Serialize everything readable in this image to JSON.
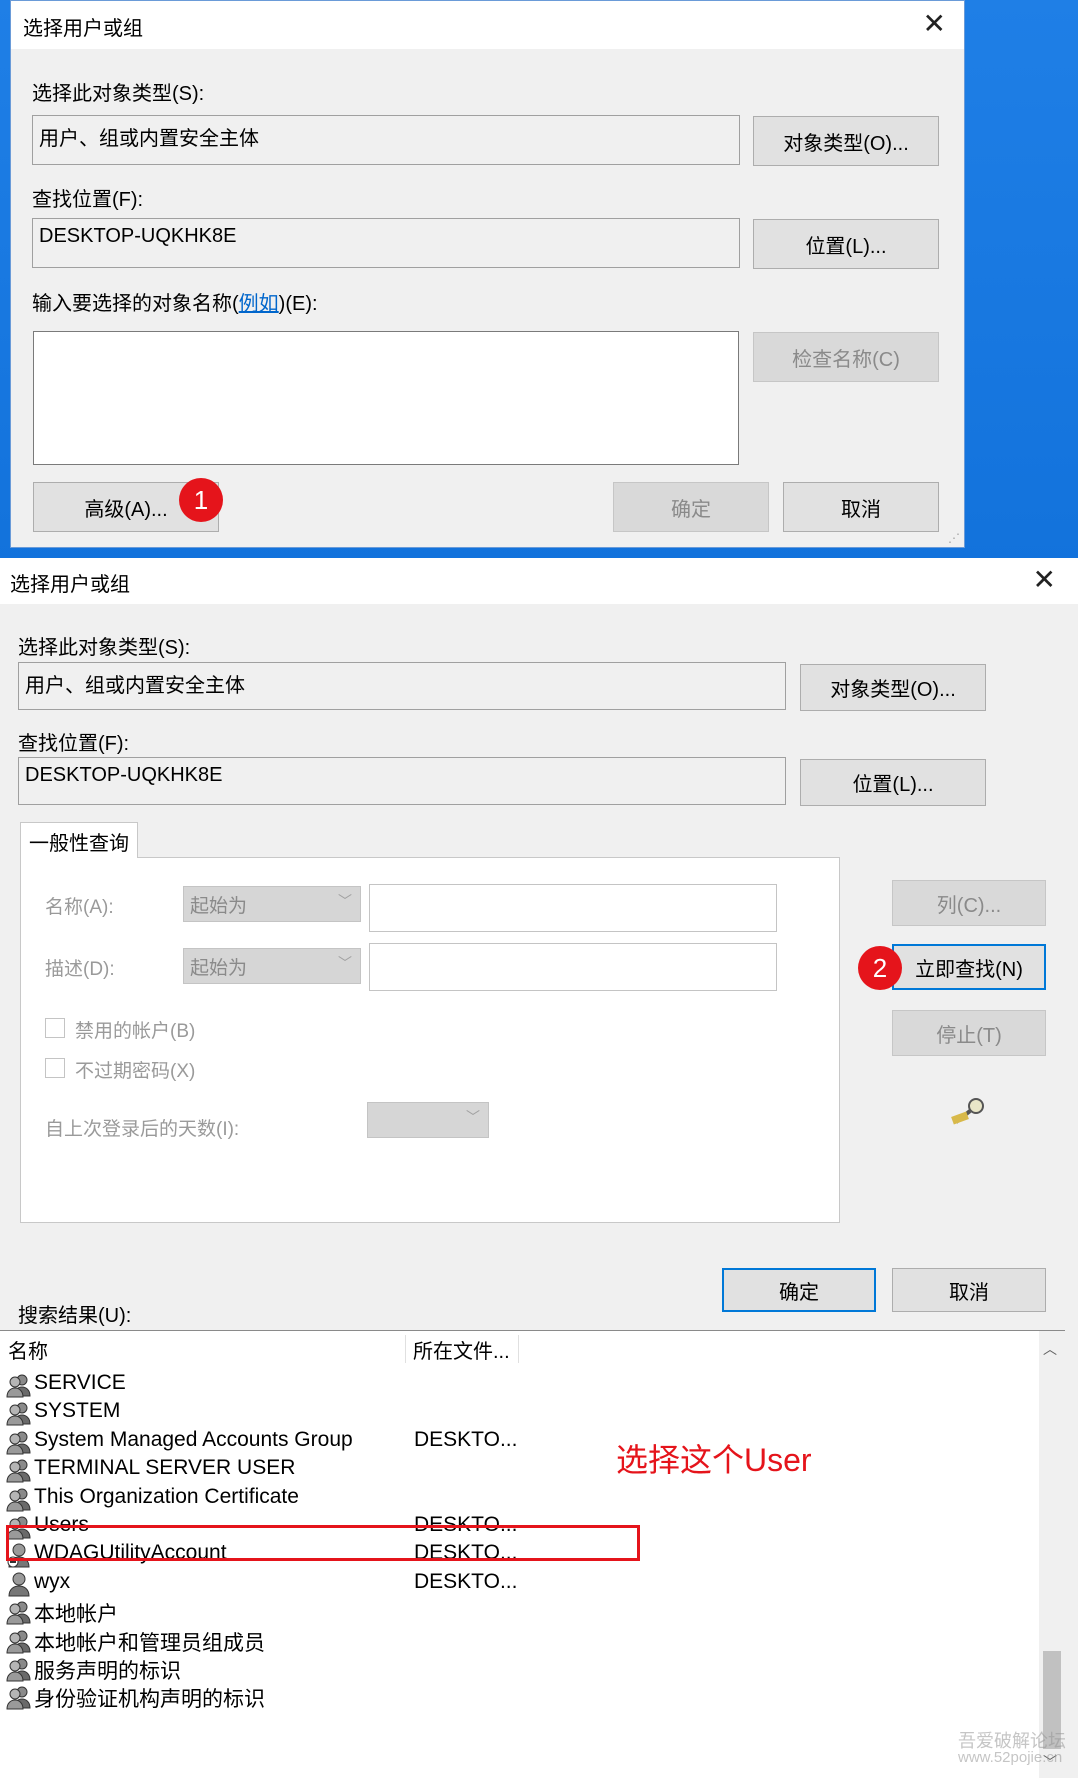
{
  "dialog1": {
    "title": "选择用户或组",
    "object_types_label": "选择此对象类型(S):",
    "object_types_value": "用户、组或内置安全主体",
    "object_types_button": "对象类型(O)...",
    "location_label": "查找位置(F):",
    "location_value": "DESKTOP-UQKHK8E",
    "location_button": "位置(L)...",
    "enter_names_prefix": "输入要选择的对象名称(",
    "enter_names_link": "例如",
    "enter_names_suffix": ")(E):",
    "check_names_button": "检查名称(C)",
    "advanced_button": "高级(A)...",
    "ok_button": "确定",
    "cancel_button": "取消",
    "badge": "1"
  },
  "dialog2": {
    "title": "选择用户或组",
    "object_types_label": "选择此对象类型(S):",
    "object_types_value": "用户、组或内置安全主体",
    "object_types_button": "对象类型(O)...",
    "location_label": "查找位置(F):",
    "location_value": "DESKTOP-UQKHK8E",
    "location_button": "位置(L)...",
    "tab_label": "一般性查询",
    "name_label": "名称(A):",
    "name_combo": "起始为",
    "desc_label": "描述(D):",
    "desc_combo": "起始为",
    "disabled_accounts": "禁用的帐户(B)",
    "non_expiring": "不过期密码(X)",
    "days_since_logon": "自上次登录后的天数(I):",
    "columns_button": "列(C)...",
    "find_now_button": "立即查找(N)",
    "stop_button": "停止(T)",
    "ok_button": "确定",
    "cancel_button": "取消",
    "search_results_label": "搜索结果(U):",
    "badge": "2"
  },
  "results": {
    "columns": [
      "名称",
      "所在文件..."
    ],
    "rows": [
      {
        "name": "SERVICE",
        "folder": "",
        "icon": "group-icon"
      },
      {
        "name": "SYSTEM",
        "folder": "",
        "icon": "group-icon"
      },
      {
        "name": "System Managed Accounts Group",
        "folder": "DESKTO...",
        "icon": "group-icon"
      },
      {
        "name": "TERMINAL SERVER USER",
        "folder": "",
        "icon": "group-icon"
      },
      {
        "name": "This Organization Certificate",
        "folder": "",
        "icon": "group-icon"
      },
      {
        "name": "Users",
        "folder": "DESKTO...",
        "icon": "group-icon"
      },
      {
        "name": "WDAGUtilityAccount",
        "folder": "DESKTO...",
        "icon": "disabled-user-icon"
      },
      {
        "name": "wyx",
        "folder": "DESKTO...",
        "icon": "user-icon"
      },
      {
        "name": "本地帐户",
        "folder": "",
        "icon": "group-icon"
      },
      {
        "name": "本地帐户和管理员组成员",
        "folder": "",
        "icon": "group-icon"
      },
      {
        "name": "服务声明的标识",
        "folder": "",
        "icon": "group-icon"
      },
      {
        "name": "身份验证机构声明的标识",
        "folder": "",
        "icon": "group-icon"
      }
    ]
  },
  "annotation": {
    "text": "选择这个User",
    "color": "#e5141b"
  },
  "watermark": {
    "line1": "吾爱破解论坛",
    "line2": "www.52pojie.cn"
  }
}
